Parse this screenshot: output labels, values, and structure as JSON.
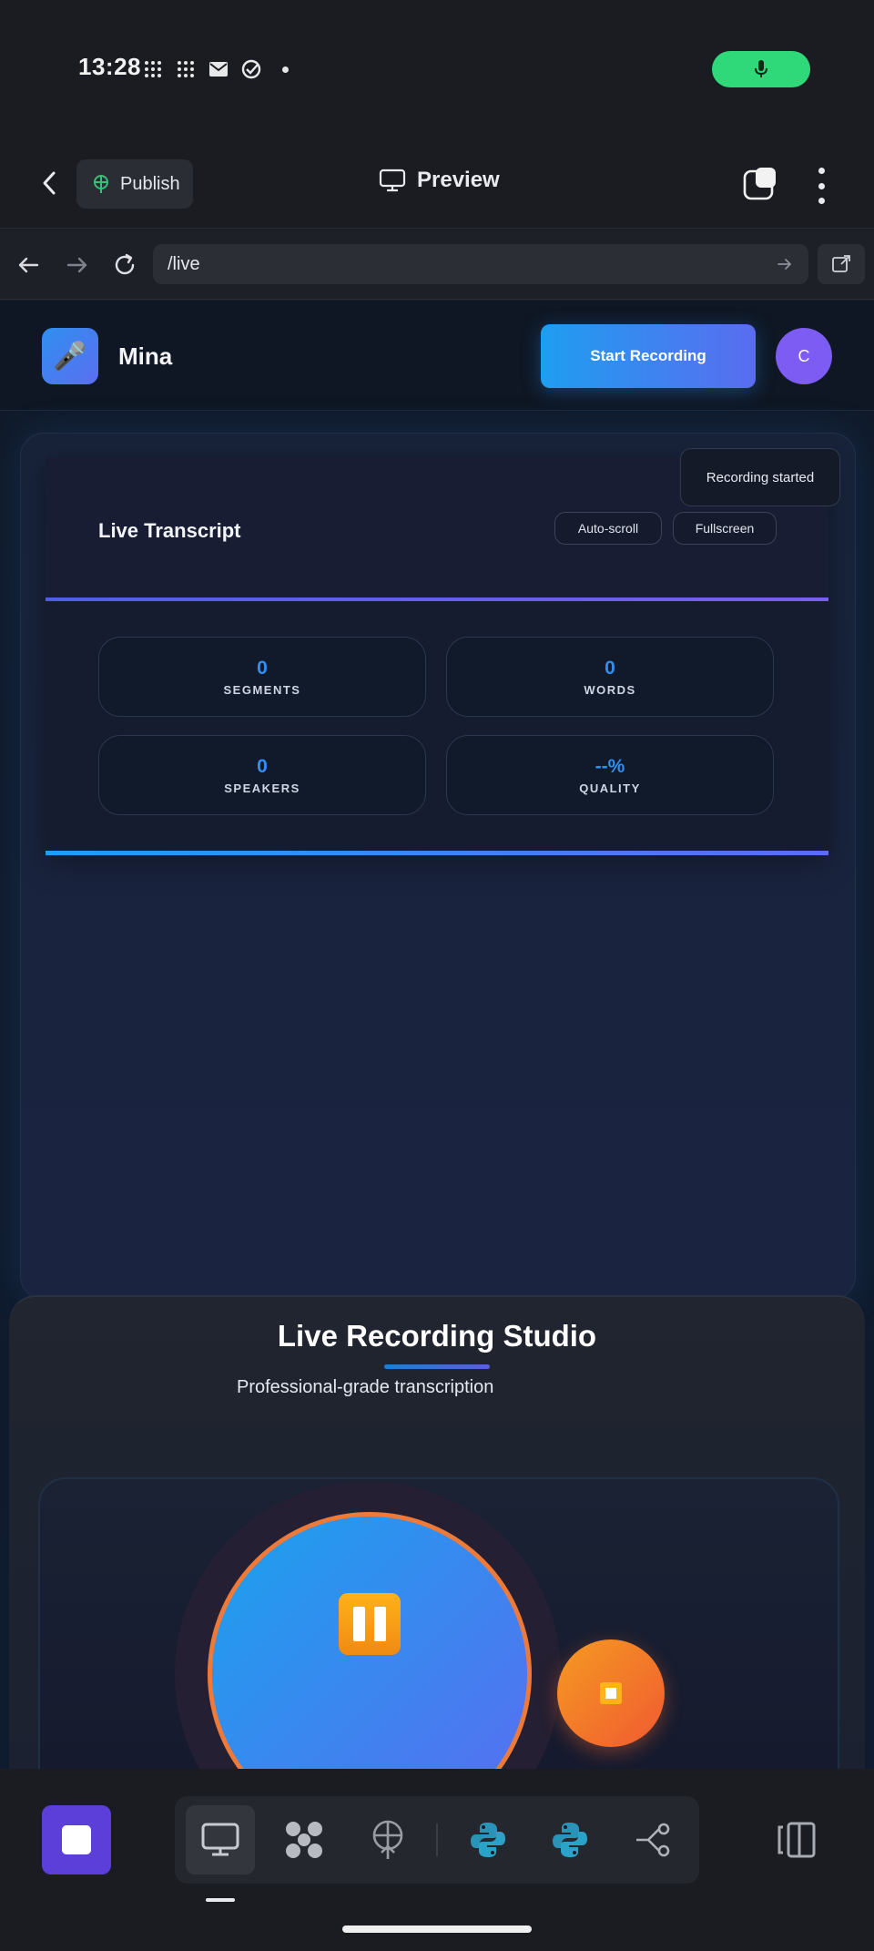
{
  "status_bar": {
    "time": "13:28"
  },
  "app_bar": {
    "publish_label": "Publish",
    "preview_label": "Preview"
  },
  "url_bar": {
    "path": "/live"
  },
  "site_header": {
    "brand": "Mina",
    "start_label": "Start Recording",
    "avatar_initial": "C",
    "logo_emoji": "🎤"
  },
  "transcript": {
    "title": "Live Transcript",
    "auto_scroll_label": "Auto-scroll",
    "fullscreen_label": "Fullscreen",
    "toast": "Recording started",
    "stats": [
      {
        "value": "0",
        "label": "SEGMENTS"
      },
      {
        "value": "0",
        "label": "WORDS"
      },
      {
        "value": "0",
        "label": "SPEAKERS"
      },
      {
        "value": "--%",
        "label": "QUALITY"
      }
    ]
  },
  "studio": {
    "title": "Live Recording Studio",
    "subtitle": "Professional-grade transcription"
  },
  "colors": {
    "accent_blue": "#1e9ef0",
    "accent_purple": "#5a6cf0",
    "mic_green": "#2fd97a",
    "stop_orange": "#f05a30"
  },
  "icons": [
    "chevron-left-icon",
    "publish-icon",
    "monitor-icon",
    "tabs-icon",
    "more-icon",
    "back-arrow-icon",
    "forward-arrow-icon",
    "reload-icon",
    "go-arrow-icon",
    "external-link-icon",
    "pause-icon",
    "stop-icon",
    "python-icon",
    "share-icon",
    "panel-icon"
  ]
}
